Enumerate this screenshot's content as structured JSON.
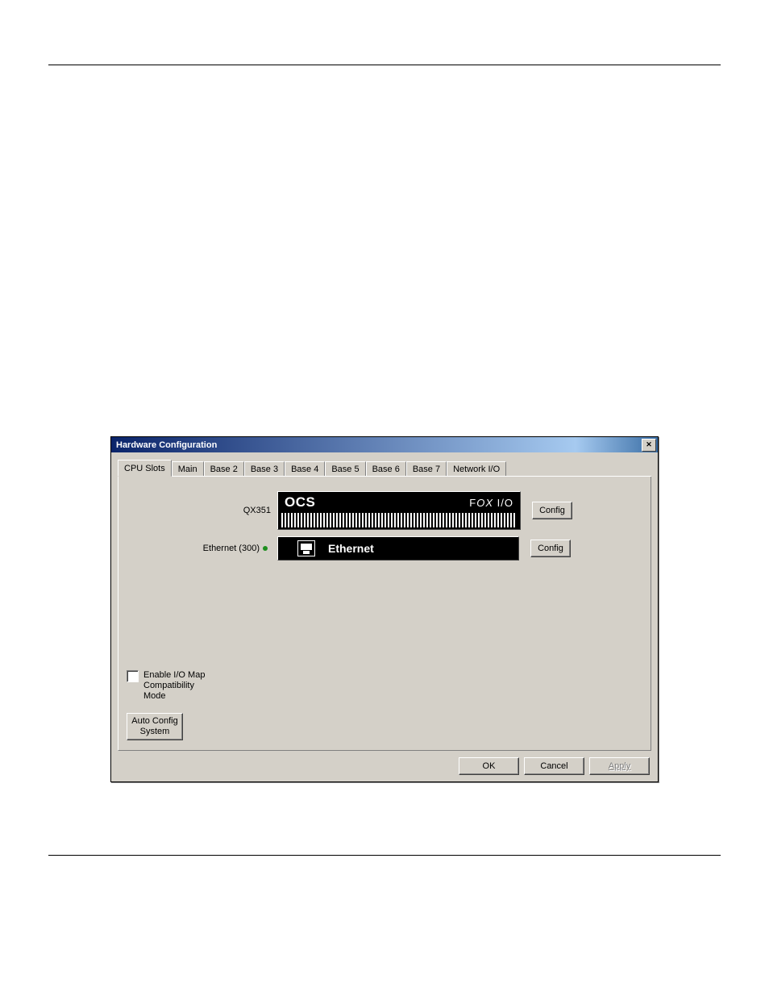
{
  "dialog": {
    "title": "Hardware Configuration",
    "tabs": [
      "CPU Slots",
      "Main",
      "Base 2",
      "Base 3",
      "Base 4",
      "Base 5",
      "Base 6",
      "Base 7",
      "Network I/O"
    ],
    "active_tab": 0,
    "row1": {
      "label": "QX351",
      "ocs": "OCS",
      "fox_f": "F",
      "fox_ox": "OX",
      "fox_io": " I/O"
    },
    "row2": {
      "label": "Ethernet (300)",
      "text": "Ethernet"
    },
    "config_btn": "Config",
    "checkbox_label": "Enable I/O Map Compatibility Mode",
    "autoconfig": "Auto Config System",
    "buttons": {
      "ok": "OK",
      "cancel": "Cancel",
      "apply": "Apply"
    }
  }
}
